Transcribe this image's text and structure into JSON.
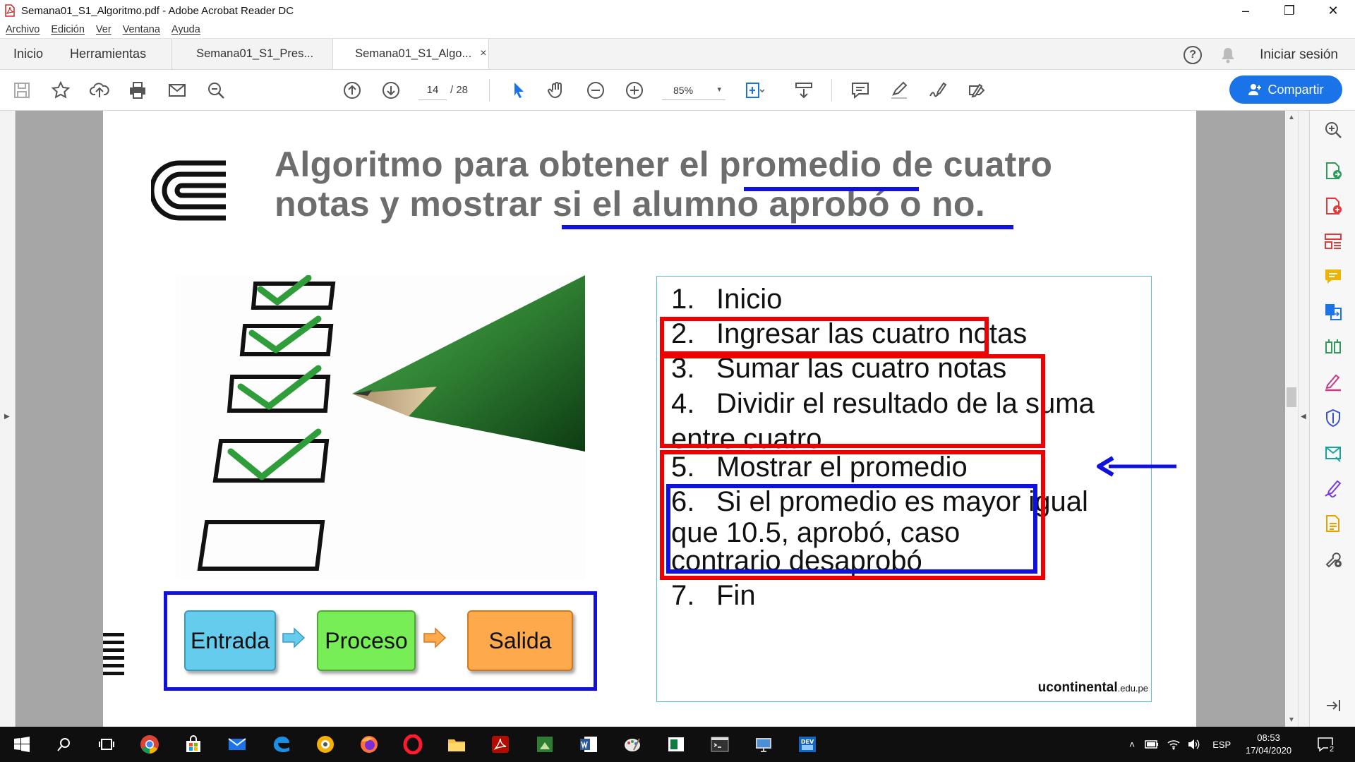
{
  "window": {
    "title": "Semana01_S1_Algoritmo.pdf - Adobe Acrobat Reader DC",
    "controls": [
      "–",
      "❐",
      "✕"
    ]
  },
  "menu": [
    "Archivo",
    "Edición",
    "Ver",
    "Ventana",
    "Ayuda"
  ],
  "tabs": {
    "home": "Inicio",
    "tools": "Herramientas",
    "doc1": "Semana01_S1_Pres...",
    "doc2": "Semana01_S1_Algo...",
    "close": "×",
    "help": "?",
    "signin": "Iniciar sesión"
  },
  "toolbar": {
    "page_current": "14",
    "page_total": "/ 28",
    "zoom": "85%",
    "zoom_caret": "▾",
    "share_label": "Compartir"
  },
  "slide": {
    "title_line1": "Algoritmo para obtener el promedio de cuatro",
    "title_line2": "notas y mostrar si el alumno aprobó o no.",
    "flow": [
      "Entrada",
      "Proceso",
      "Salida"
    ],
    "steps": [
      {
        "num": "1.",
        "text": "Inicio"
      },
      {
        "num": "2.",
        "text": "Ingresar las cuatro notas"
      },
      {
        "num": "3.",
        "text": "Sumar las cuatro notas"
      },
      {
        "num": "4.",
        "text": "Dividir el resultado de la suma",
        "cont": [
          "entre cuatro"
        ]
      },
      {
        "num": "5.",
        "text": "Mostrar el promedio"
      },
      {
        "num": "6.",
        "text": "Si el promedio es mayor igual",
        "cont": [
          "que 10.5, aprobó, caso",
          "contrario desaprobó"
        ]
      },
      {
        "num": "7.",
        "text": "Fin"
      }
    ],
    "brand": "ucontinental",
    "brand_suffix": ".edu.pe"
  },
  "taskbar": {
    "lang": "ESP",
    "time": "08:53",
    "date": "17/04/2020",
    "notifications": "2"
  },
  "colors": {
    "accent_blue": "#1a73e8",
    "highlight_red": "#ee0000",
    "highlight_blue": "#1111dd"
  }
}
